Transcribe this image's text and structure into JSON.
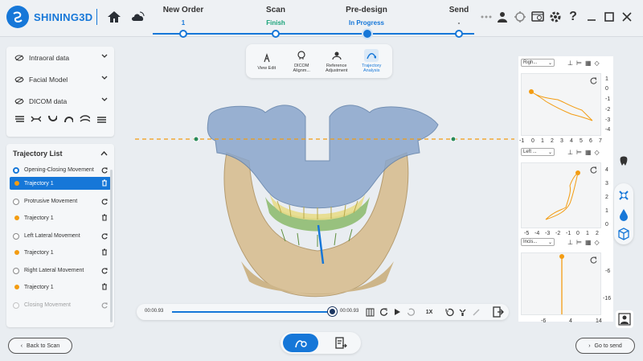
{
  "app": {
    "brand": "SHINING3D"
  },
  "steps": [
    {
      "title": "New Order",
      "status": "1",
      "state": "done"
    },
    {
      "title": "Scan",
      "status": "Finish",
      "state": "done"
    },
    {
      "title": "Pre-design",
      "status": "In Progress",
      "state": "active"
    },
    {
      "title": "Send",
      "status": "-",
      "state": "pending"
    }
  ],
  "left_panel": {
    "layers": [
      {
        "label": "Intraoral data",
        "icon": "eye-icon"
      },
      {
        "label": "Facial Model",
        "icon": "eye-icon"
      },
      {
        "label": "DICOM data",
        "icon": "eye-icon"
      }
    ]
  },
  "trajectory": {
    "title": "Trajectory List",
    "movements": [
      {
        "label": "Opening-Closing Movement",
        "selected": true,
        "trajectory": "Trajectory 1",
        "trajectory_selected": true
      },
      {
        "label": "Protrusive Movement",
        "selected": false,
        "trajectory": "Trajectory 1",
        "trajectory_selected": false
      },
      {
        "label": "Left Lateral Movement",
        "selected": false,
        "trajectory": "Trajectory 1",
        "trajectory_selected": false
      },
      {
        "label": "Right Lateral Movement",
        "selected": false,
        "trajectory": "Trajectory 1",
        "trajectory_selected": false
      },
      {
        "label": "Closing Movement",
        "selected": false,
        "trajectory": "",
        "trajectory_selected": false
      }
    ]
  },
  "tool_tabs": [
    {
      "label": "View Edit",
      "active": false
    },
    {
      "label": "DICOM Alignm...",
      "active": false
    },
    {
      "label": "Reference Adjustment",
      "active": false
    },
    {
      "label": "Trajectory Analysis",
      "active": true
    }
  ],
  "playback": {
    "current": "00:00.93",
    "total": "00:00.93",
    "speed": "1X",
    "progress": 1.0
  },
  "plots": [
    {
      "view": "Righ...",
      "x_ticks": [
        "-1",
        "0",
        "1",
        "2",
        "3",
        "4",
        "5",
        "6",
        "7"
      ],
      "y_ticks": [
        "1",
        "0",
        "-1",
        "-2",
        "-3",
        "-4"
      ]
    },
    {
      "view": "Left ...",
      "x_ticks": [
        "-5",
        "-4",
        "-3",
        "-2",
        "-1",
        "0",
        "1",
        "2"
      ],
      "y_ticks": [
        "4",
        "3",
        "2",
        "1",
        "0"
      ]
    },
    {
      "view": "Incis...",
      "x_ticks": [
        "-6",
        "4",
        "14"
      ],
      "y_ticks": [
        "-6",
        "-16"
      ]
    }
  ],
  "footer": {
    "back": "Back to Scan",
    "next": "Go to send"
  },
  "colors": {
    "accent": "#1677d8",
    "trajectory": "#f39c12",
    "finish": "#1aa37a"
  }
}
